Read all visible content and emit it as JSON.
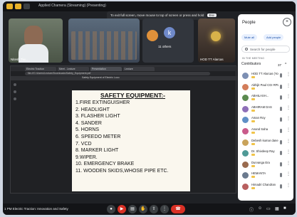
{
  "topbar": {
    "title": "Applied Chamera (Streaming) (Presenting)",
    "fullscreen_notice": "To exit full screen, move mouse to top of screen or press and hold",
    "exit_key": "Esc"
  },
  "tiles": [
    {
      "name": "Nitesh Tiw..."
    },
    {
      "name": ""
    },
    {
      "name": "11 others",
      "avatar_letter": "k"
    },
    {
      "name": "HOD TT Alarcas"
    }
  ],
  "browser": {
    "tabs": [
      "Electric Traction",
      "Meet - Lecture",
      "Presentation",
      "Lecture"
    ],
    "url": "file:///C:/Users/Lecture/Downloads/Safety_Equipment.pdf",
    "page_label": "Safety Equipment of Electric Loco"
  },
  "slide": {
    "title": "SAFETY EQUIPMENT:-",
    "items": [
      "1.FIRE EXTINGUISHER",
      "2. HEADLIGHT",
      "3. FLASHER LIGHT",
      "4. SANDER",
      "5. HORNS",
      "6. SPEEDO METER",
      "7. VCD",
      "8. MARKER LIGHT",
      "9.WIPER.",
      "10. EMERGENCY BRAKE",
      "11. WOODEN SKIDS,WHOSE PIPE ETC."
    ]
  },
  "people": {
    "title": "People",
    "close_icon": "close-icon",
    "add_label": "Add people",
    "mute_label": "Mute all",
    "search_placeholder": "Search for people",
    "section_label": "IN THE MEETING",
    "group_label": "Contributors",
    "group_count": "37",
    "participants": [
      {
        "name": "HOD TT Alarcas (You)",
        "color": "#7d8fb3"
      },
      {
        "name": "Abhijit Paul CGI RPLY",
        "color": "#d37d5a"
      },
      {
        "name": "ABHILASH...",
        "color": "#5b8a4f"
      },
      {
        "name": "ABHIRAM DAS",
        "color": "#8e6fb8"
      },
      {
        "name": "Aman Roy",
        "color": "#5f8fc6"
      },
      {
        "name": "Anand Saha",
        "color": "#c95b8b"
      },
      {
        "name": "Debesh kumar dane",
        "color": "#c9a35b"
      },
      {
        "name": "Dr. Shivdeep Ray",
        "color": "#4f9a96"
      },
      {
        "name": "Durvanga Era",
        "color": "#9a6b4f"
      },
      {
        "name": "HEMANTA",
        "color": "#6b7a8e"
      },
      {
        "name": "Himadri Chandran",
        "color": "#b85f5f"
      }
    ]
  },
  "bottombar": {
    "meeting_name": "1 PM  Electric Traction: Innovation and Safety",
    "controls": [
      "mic-icon",
      "video-icon",
      "captions-icon",
      "hand-icon",
      "present-icon",
      "more-icon",
      "end-call-icon"
    ]
  }
}
